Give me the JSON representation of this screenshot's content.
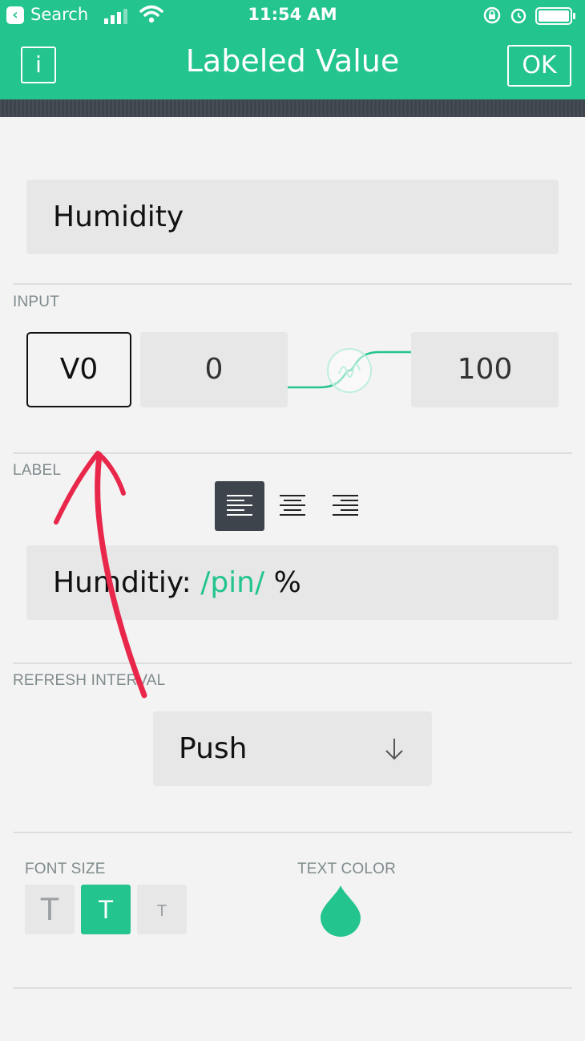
{
  "status_bar": {
    "back_app": "Search",
    "time": "11:54 AM"
  },
  "nav": {
    "info_label": "i",
    "title": "Labeled Value",
    "ok_label": "OK"
  },
  "widget_name": "Humidity",
  "input": {
    "section_label": "INPUT",
    "pin": "V0",
    "min": "0",
    "max": "100"
  },
  "label": {
    "section_label": "LABEL",
    "alignment_selected": "left",
    "text_prefix": "Humditiy: ",
    "pin_token": "/pin/",
    "text_suffix": " %"
  },
  "refresh": {
    "section_label": "REFRESH INTERVAL",
    "value": "Push"
  },
  "font_size": {
    "section_label": "FONT SIZE",
    "options": [
      "T",
      "T",
      "T"
    ],
    "selected_index": 1
  },
  "text_color": {
    "section_label": "TEXT COLOR",
    "color": "#23c48e"
  },
  "colors": {
    "accent": "#23c48e",
    "dark": "#3d444c",
    "annotation_arrow": "#e8274b"
  }
}
